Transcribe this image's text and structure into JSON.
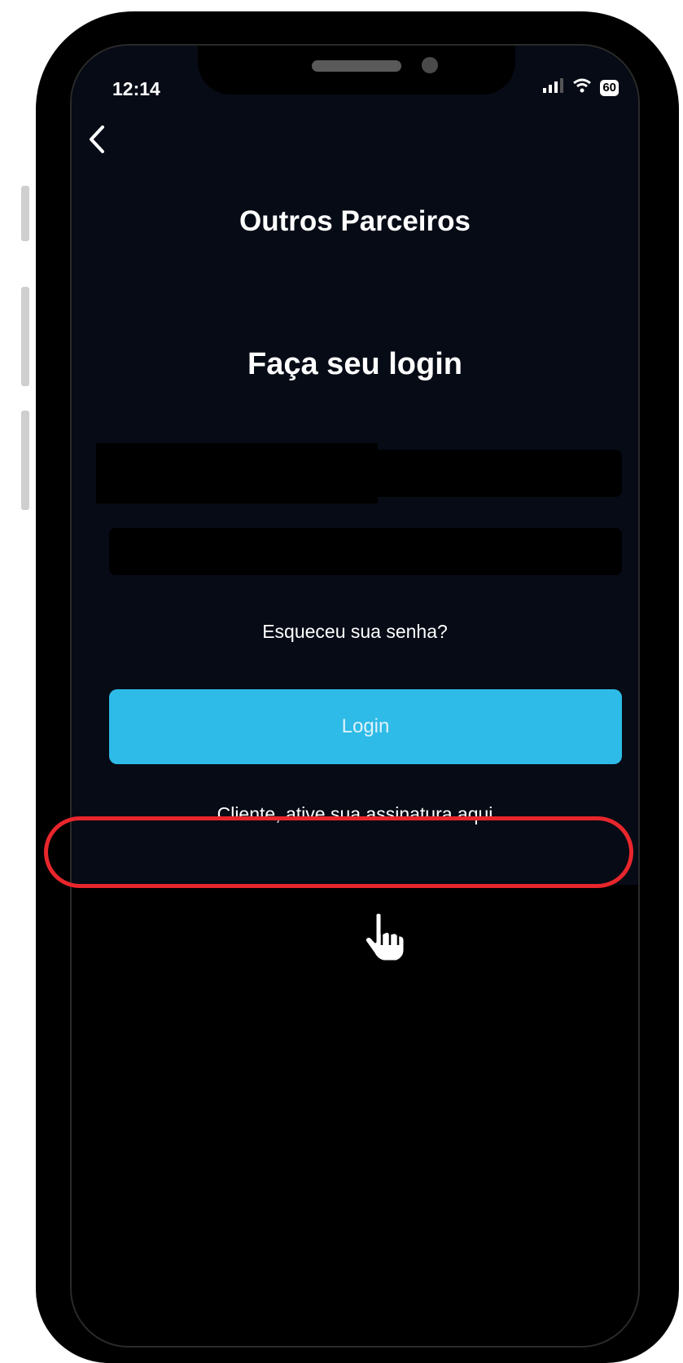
{
  "status_bar": {
    "time": "12:14",
    "battery": "60"
  },
  "header": {
    "title": "Outros Parceiros"
  },
  "login": {
    "heading": "Faça seu login",
    "username_value": "",
    "password_value": "",
    "forgot_password": "Esqueceu sua senha?",
    "login_button": "Login",
    "activate_link": "Cliente, ative sua assinatura aqui"
  },
  "colors": {
    "accent": "#2ebbe7",
    "highlight": "#e8262c",
    "background": "#060b16"
  },
  "icons": [
    "back-chevron-icon",
    "signal-icon",
    "wifi-icon",
    "battery-icon",
    "hand-cursor-icon"
  ]
}
